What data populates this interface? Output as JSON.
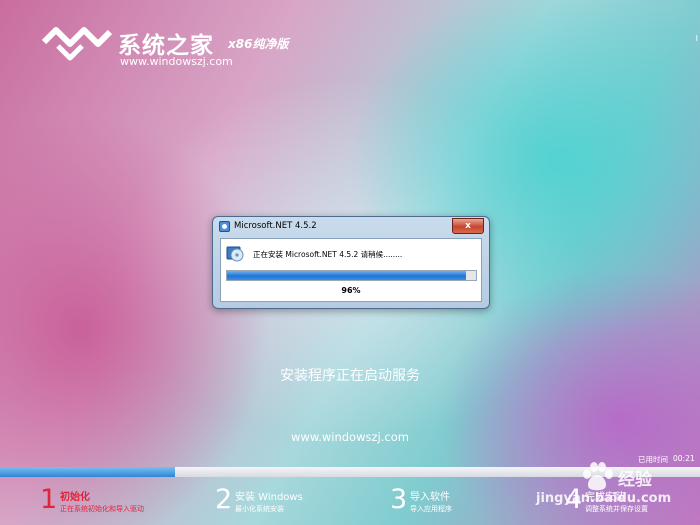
{
  "brand": {
    "title": "系统之家",
    "edition": "x86纯净版",
    "url": "www.windowszj.com",
    "corner_mark": "I"
  },
  "dialog": {
    "title": "Microsoft.NET 4.5.2",
    "close_glyph": "x",
    "message": "正在安装 Microsoft.NET 4.5.2 请稍候........",
    "progress_fraction": 0.96,
    "progress_percent": "96%"
  },
  "status_text": "安装程序正在启动服务",
  "site_url": "www.windowszj.com",
  "elapsed": {
    "label": "已用时间",
    "value": "00:21"
  },
  "overall_progress_fraction": 0.25,
  "steps": [
    {
      "number": "1",
      "title": "初始化",
      "desc": "正在系统初始化和导入驱动",
      "state": "active"
    },
    {
      "number": "2",
      "title": "安装 Windows",
      "desc": "最小化系统安装",
      "state": "inactive"
    },
    {
      "number": "3",
      "title": "导入软件",
      "desc": "导入应用程序",
      "state": "inactive"
    },
    {
      "number": "4",
      "title": "完成安装",
      "desc": "调整系统并保存设置",
      "state": "inactive"
    }
  ],
  "watermark": {
    "text1": "经验",
    "text2": "jingyan.baidu.com"
  },
  "colors": {
    "active_step": "#e0243a",
    "progress_blue": "#1f74d6",
    "dialog_frame": "#c9dced"
  }
}
